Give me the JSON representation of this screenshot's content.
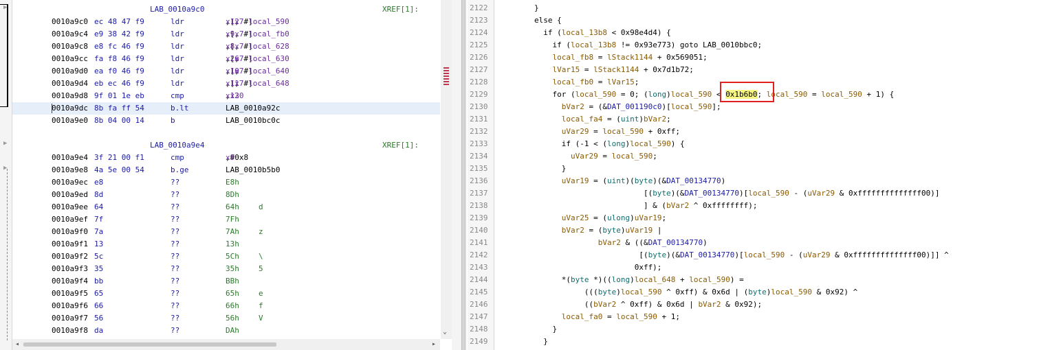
{
  "listing": {
    "block1": {
      "label": "LAB_0010a9c0",
      "xref": "XREF[1]:",
      "rows": [
        {
          "addr": "0010a9c0",
          "bytes": "ec 48 47 f9",
          "mn": "ldr",
          "op": "x12,[x7, #local_590]"
        },
        {
          "addr": "0010a9c4",
          "bytes": "e9 38 42 f9",
          "mn": "ldr",
          "op": "x9,[x7, #local_fb0]"
        },
        {
          "addr": "0010a9c8",
          "bytes": "e8 fc 46 f9",
          "mn": "ldr",
          "op": "x8,[x7, #local_628]"
        },
        {
          "addr": "0010a9cc",
          "bytes": "fa f8 46 f9",
          "mn": "ldr",
          "op": "x26,[x7, #local_630]"
        },
        {
          "addr": "0010a9d0",
          "bytes": "ea f0 46 f9",
          "mn": "ldr",
          "op": "x10,[x7, #local_640]"
        },
        {
          "addr": "0010a9d4",
          "bytes": "eb ec 46 f9",
          "mn": "ldr",
          "op": "x11,[x7, #local_648]"
        },
        {
          "addr": "0010a9d8",
          "bytes": "9f 01 1e eb",
          "mn": "cmp",
          "op": "x12,x30"
        },
        {
          "addr": "0010a9dc",
          "bytes": "8b fa ff 54",
          "mn": "b.lt",
          "op": "LAB_0010a92c"
        },
        {
          "addr": "0010a9e0",
          "bytes": "8b 04 00 14",
          "mn": "b",
          "op": "LAB_0010bc0c"
        }
      ]
    },
    "block2": {
      "label": "LAB_0010a9e4",
      "xref": "XREF[1]:",
      "rows": [
        {
          "addr": "0010a9e4",
          "bytes": "3f 21 00 f1",
          "mn": "cmp",
          "op": "x9,#0x8",
          "ch": ""
        },
        {
          "addr": "0010a9e8",
          "bytes": "4a 5e 00 54",
          "mn": "b.ge",
          "op": "LAB_0010b5b0",
          "ch": ""
        },
        {
          "addr": "0010a9ec",
          "bytes": "e8",
          "mn": "??",
          "op": "E8h",
          "ch": ""
        },
        {
          "addr": "0010a9ed",
          "bytes": "8d",
          "mn": "??",
          "op": "8Dh",
          "ch": ""
        },
        {
          "addr": "0010a9ee",
          "bytes": "64",
          "mn": "??",
          "op": "64h",
          "ch": "d"
        },
        {
          "addr": "0010a9ef",
          "bytes": "7f",
          "mn": "??",
          "op": "7Fh",
          "ch": ""
        },
        {
          "addr": "0010a9f0",
          "bytes": "7a",
          "mn": "??",
          "op": "7Ah",
          "ch": "z"
        },
        {
          "addr": "0010a9f1",
          "bytes": "13",
          "mn": "??",
          "op": "13h",
          "ch": ""
        },
        {
          "addr": "0010a9f2",
          "bytes": "5c",
          "mn": "??",
          "op": "5Ch",
          "ch": "\\"
        },
        {
          "addr": "0010a9f3",
          "bytes": "35",
          "mn": "??",
          "op": "35h",
          "ch": "5"
        },
        {
          "addr": "0010a9f4",
          "bytes": "bb",
          "mn": "??",
          "op": "BBh",
          "ch": ""
        },
        {
          "addr": "0010a9f5",
          "bytes": "65",
          "mn": "??",
          "op": "65h",
          "ch": "e"
        },
        {
          "addr": "0010a9f6",
          "bytes": "66",
          "mn": "??",
          "op": "66h",
          "ch": "f"
        },
        {
          "addr": "0010a9f7",
          "bytes": "56",
          "mn": "??",
          "op": "56h",
          "ch": "V"
        },
        {
          "addr": "0010a9f8",
          "bytes": "da",
          "mn": "??",
          "op": "DAh",
          "ch": ""
        }
      ]
    }
  },
  "decompile": {
    "lines": [
      {
        "n": "2122",
        "code": "}"
      },
      {
        "n": "2123",
        "code": "else {"
      },
      {
        "n": "2124",
        "code": "  if (local_13b8 < 0x98e4d4) {"
      },
      {
        "n": "2125",
        "code": "    if (local_13b8 != 0x93e773) goto LAB_0010bbc0;"
      },
      {
        "n": "2126",
        "code": "    local_fb8 = lStack1144 + 0x569051;"
      },
      {
        "n": "2127",
        "code": "    lVar15 = lStack1144 + 0x7d1b72;"
      },
      {
        "n": "2128",
        "code": "    local_fb0 = lVar15;"
      },
      {
        "n": "2129",
        "code": "    for (local_590 = 0; (long)local_590 < 0x1b6b0; local_590 = local_590 + 1) {"
      },
      {
        "n": "2130",
        "code": "      bVar2 = (&DAT_001190c0)[local_590];"
      },
      {
        "n": "2131",
        "code": "      local_fa4 = (uint)bVar2;"
      },
      {
        "n": "2132",
        "code": "      uVar29 = local_590 + 0xff;"
      },
      {
        "n": "2133",
        "code": "      if (-1 < (long)local_590) {"
      },
      {
        "n": "2134",
        "code": "        uVar29 = local_590;"
      },
      {
        "n": "2135",
        "code": "      }"
      },
      {
        "n": "2136",
        "code": "      uVar19 = (uint)(byte)(&DAT_00134770)"
      },
      {
        "n": "2137",
        "code": "                        [(byte)(&DAT_00134770)[local_590 - (uVar29 & 0xffffffffffffff00)]"
      },
      {
        "n": "2138",
        "code": "                        ] & (bVar2 ^ 0xffffffff);"
      },
      {
        "n": "2139",
        "code": "      uVar25 = (ulong)uVar19;"
      },
      {
        "n": "2140",
        "code": "      bVar2 = (byte)uVar19 |"
      },
      {
        "n": "2141",
        "code": "              bVar2 & ((&DAT_00134770)"
      },
      {
        "n": "2142",
        "code": "                       [(byte)(&DAT_00134770)[local_590 - (uVar29 & 0xffffffffffffff00)]] ^"
      },
      {
        "n": "2143",
        "code": "                      0xff);"
      },
      {
        "n": "2144",
        "code": "      *(byte *)((long)local_648 + local_590) ="
      },
      {
        "n": "2145",
        "code": "           (((byte)local_590 ^ 0xff) & 0x6d | (byte)local_590 & 0x92) ^"
      },
      {
        "n": "2146",
        "code": "           ((bVar2 ^ 0xff) & 0x6d | bVar2 & 0x92);"
      },
      {
        "n": "2147",
        "code": "      local_fa0 = local_590 + 1;"
      },
      {
        "n": "2148",
        "code": "    }"
      },
      {
        "n": "2149",
        "code": "  }"
      }
    ]
  }
}
